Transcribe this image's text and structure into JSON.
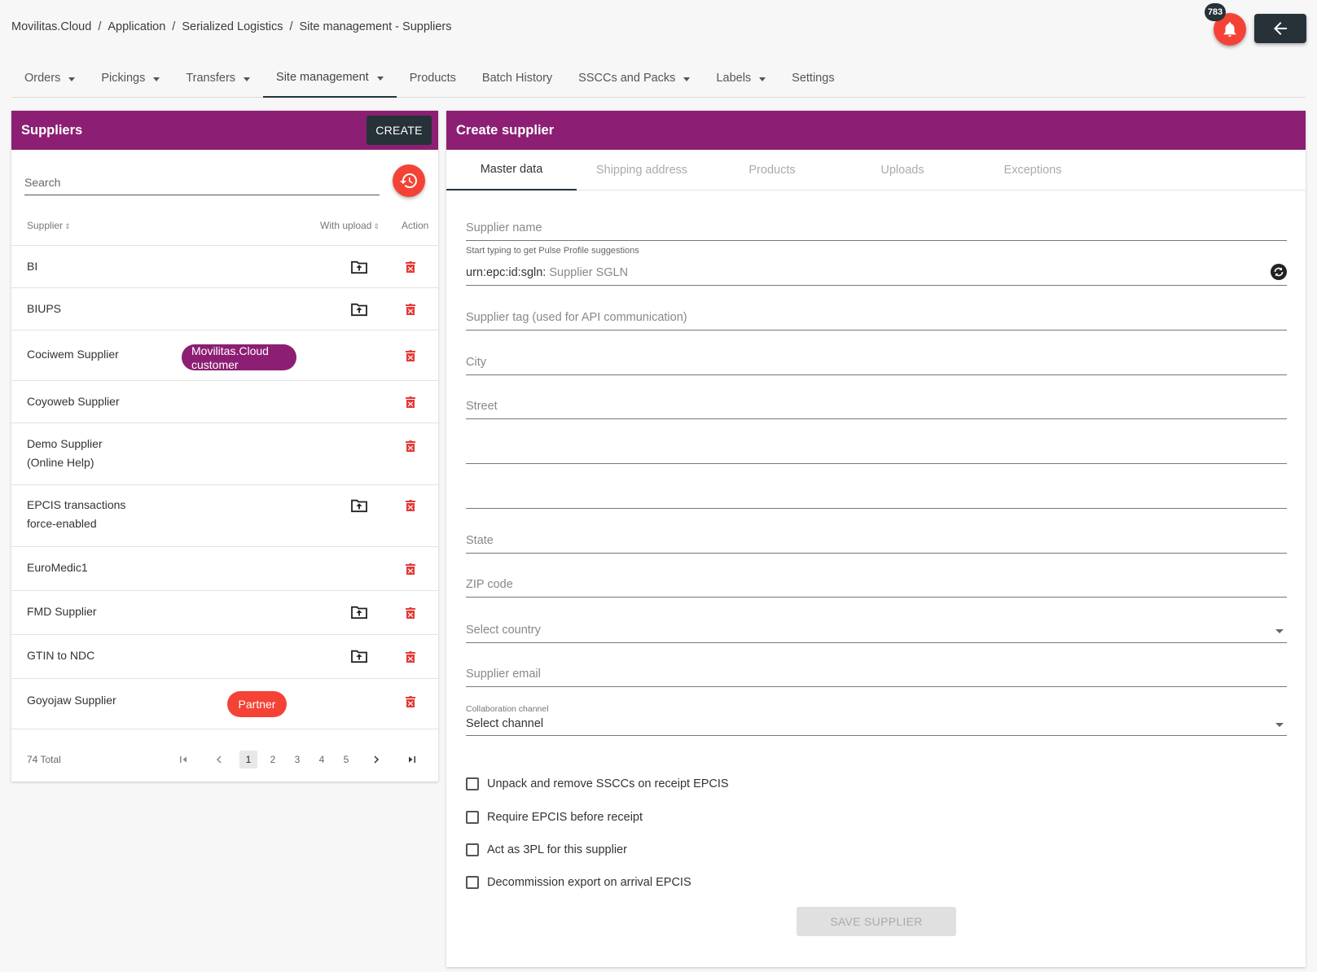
{
  "breadcrumb": [
    "Movilitas.Cloud",
    "Application",
    "Serialized Logistics",
    "Site management - Suppliers"
  ],
  "breadcrumb_sep": "/",
  "notifications": {
    "count": "783",
    "icon": "bell-icon"
  },
  "back_icon": "arrow-left-icon",
  "nav": [
    {
      "label": "Orders",
      "dropdown": true
    },
    {
      "label": "Pickings",
      "dropdown": true
    },
    {
      "label": "Transfers",
      "dropdown": true
    },
    {
      "label": "Site management",
      "dropdown": true,
      "active": true
    },
    {
      "label": "Products",
      "dropdown": false
    },
    {
      "label": "Batch History",
      "dropdown": false
    },
    {
      "label": "SSCCs and Packs",
      "dropdown": true
    },
    {
      "label": "Labels",
      "dropdown": true
    },
    {
      "label": "Settings",
      "dropdown": false
    }
  ],
  "suppliers_panel": {
    "title": "Suppliers",
    "create_label": "CREATE",
    "search_placeholder": "Search",
    "columns": {
      "supplier": "Supplier",
      "with_upload": "With upload",
      "action": "Action"
    },
    "rows": [
      {
        "name": "BI",
        "upload": true,
        "badge": null
      },
      {
        "name": "BIUPS",
        "upload": true,
        "badge": null
      },
      {
        "name": "Cociwem Supplier",
        "upload": false,
        "badge": "Movilitas.Cloud customer"
      },
      {
        "name": "Coyoweb Supplier",
        "upload": false,
        "badge": null
      },
      {
        "name": "Demo Supplier (Online Help)",
        "upload": false,
        "badge": null
      },
      {
        "name": "EPCIS transactions force-enabled",
        "upload": true,
        "badge": null
      },
      {
        "name": "EuroMedic1",
        "upload": false,
        "badge": null
      },
      {
        "name": "FMD Supplier",
        "upload": true,
        "badge": null
      },
      {
        "name": "GTIN to NDC",
        "upload": true,
        "badge": null
      },
      {
        "name": "Goyojaw Supplier",
        "upload": false,
        "badge": "Partner"
      }
    ],
    "total": "74 Total",
    "pages": [
      "1",
      "2",
      "3",
      "4",
      "5"
    ],
    "current_page": "1"
  },
  "create_panel": {
    "title": "Create supplier",
    "tabs": [
      "Master data",
      "Shipping address",
      "Products",
      "Uploads",
      "Exceptions"
    ],
    "active_tab": "Master data",
    "fields": {
      "supplier_name": "Supplier name",
      "supplier_name_hint": "Start typing to get Pulse Profile suggestions",
      "sgln_prefix": "urn:epc:id:sgln:",
      "sgln_placeholder": "Supplier SGLN",
      "supplier_tag": "Supplier tag (used for API communication)",
      "city": "City",
      "street": "Street",
      "street2": "",
      "street3": "",
      "state": "State",
      "zip": "ZIP code",
      "country": "Select country",
      "email": "Supplier email",
      "collab_label": "Collaboration channel",
      "collab_value": "Select channel"
    },
    "checkboxes": [
      "Unpack and remove SSCCs on receipt EPCIS",
      "Require EPCIS before receipt",
      "Act as 3PL for this supplier",
      "Decommission export on arrival EPCIS"
    ],
    "save_label": "SAVE SUPPLIER"
  },
  "colors": {
    "header": "#8c1f73",
    "accent_red": "#f44336",
    "dark": "#263238"
  }
}
